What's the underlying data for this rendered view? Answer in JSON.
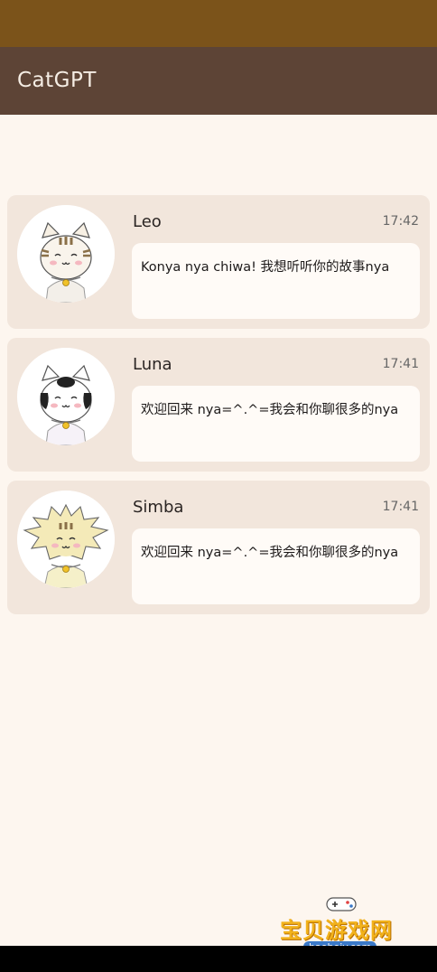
{
  "app_bar": {
    "title": "CatGPT"
  },
  "colors": {
    "status_bar": "#7b531a",
    "app_bar": "#5d4436",
    "background": "#fdf6ef",
    "card": "#f2e6dc",
    "bubble": "#fffbf7"
  },
  "chats": [
    {
      "name": "Leo",
      "time": "17:42",
      "message": "Konya nya chiwa! 我想听听你的故事nya",
      "avatar_icon": "tabby-cat-avatar-icon"
    },
    {
      "name": "Luna",
      "time": "17:41",
      "message": "欢迎回来 nya=^.^=我会和你聊很多的nya",
      "avatar_icon": "spotted-cat-avatar-icon"
    },
    {
      "name": "Simba",
      "time": "17:41",
      "message": "欢迎回来 nya=^.^=我会和你聊很多的nya",
      "avatar_icon": "lion-cat-avatar-icon"
    }
  ],
  "watermark": {
    "text": "宝贝游戏网",
    "url": "baobeiy.com"
  }
}
